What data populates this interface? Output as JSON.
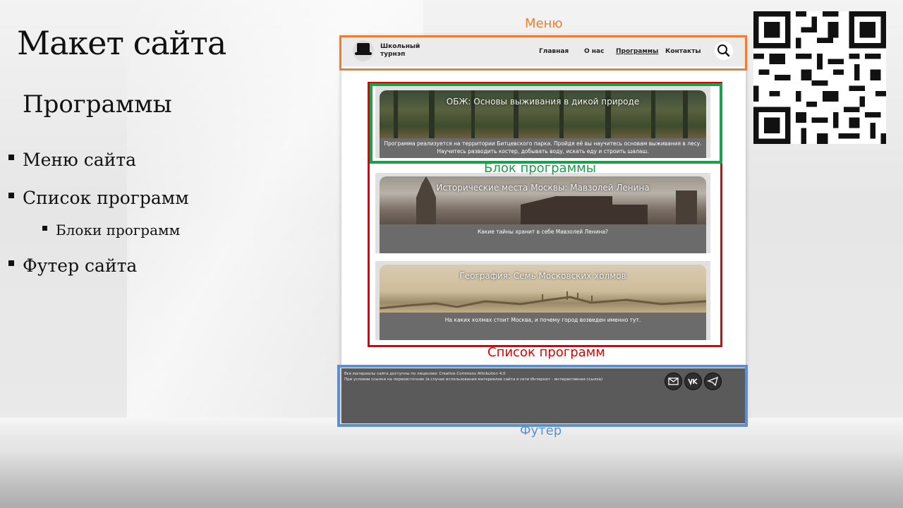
{
  "slide": {
    "title": "Макет сайта",
    "subtitle": "Программы",
    "bullets": [
      "Меню сайта",
      "Список программ",
      "Блоки программ",
      "Футер сайта"
    ]
  },
  "annotations": {
    "menu": "Меню",
    "program_block": "Блок программы",
    "program_list": "Список программ",
    "footer": "Футер",
    "colors": {
      "menu": "#ed7d31",
      "block": "#1aa04a",
      "list": "#e40000",
      "footer": "#5b8fcf"
    }
  },
  "mockup": {
    "logo_text": "Школьный турнэп",
    "nav": [
      "Главная",
      "О нас",
      "Программы",
      "Контакты"
    ],
    "active_nav": "Программы",
    "programs": [
      {
        "title": "ОБЖ: Основы выживания в дикой природе",
        "description": "Программа реализуется на территории Битцевского парка. Пройдя её вы научитесь основам выживания в лесу. Научитесь разводить костер, добывать воду, искать еду и строить шалаш."
      },
      {
        "title": "Исторические места Москвы: Мавзолей Ленина",
        "description": "Какие тайны хранит в себе Мавзолей Ленина?"
      },
      {
        "title": "География: Семь Московских холмов",
        "description": "На каких холмах стоит Москва, и почему город возведен именно тут."
      }
    ],
    "footer": {
      "line1": "Все материалы сайта доступны по лицензии: Creative Commons Attribution 4.0",
      "line2": "При условии ссылки на первоисточник (в случае использования материалов сайта в сети Интернет - интерактивная ссылка)"
    }
  }
}
